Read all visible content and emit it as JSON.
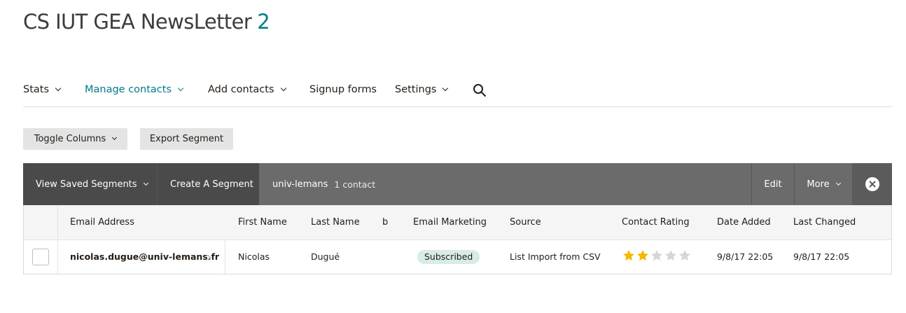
{
  "page": {
    "title": "CS IUT GEA NewsLetter",
    "count": "2"
  },
  "nav": {
    "stats": "Stats",
    "manage_contacts": "Manage contacts",
    "add_contacts": "Add contacts",
    "signup_forms": "Signup forms",
    "settings": "Settings"
  },
  "toolbar": {
    "toggle_columns": "Toggle Columns",
    "export_segment": "Export Segment"
  },
  "segment_bar": {
    "view_saved": "View Saved Segments",
    "create": "Create A Segment",
    "segment_name": "univ-lemans",
    "contact_count": "1 contact",
    "edit": "Edit",
    "more": "More"
  },
  "table": {
    "headers": [
      "Email Address",
      "First Name",
      "Last Name",
      "b",
      "Email Marketing",
      "Source",
      "Contact Rating",
      "Date Added",
      "Last Changed"
    ],
    "rows": [
      {
        "email": "nicolas.dugue@univ-lemans.fr",
        "first_name": "Nicolas",
        "last_name": "Dugué",
        "b": "",
        "email_marketing": "Subscribed",
        "source": "List Import from CSV",
        "rating": 2,
        "rating_max": 5,
        "date_added": "9/8/17 22:05",
        "last_changed": "9/8/17 22:05"
      }
    ]
  },
  "colors": {
    "accent": "#007c89",
    "star_filled": "#f5b800",
    "star_empty": "#d6d6d6",
    "subscribed_badge": "#d7ece6"
  }
}
